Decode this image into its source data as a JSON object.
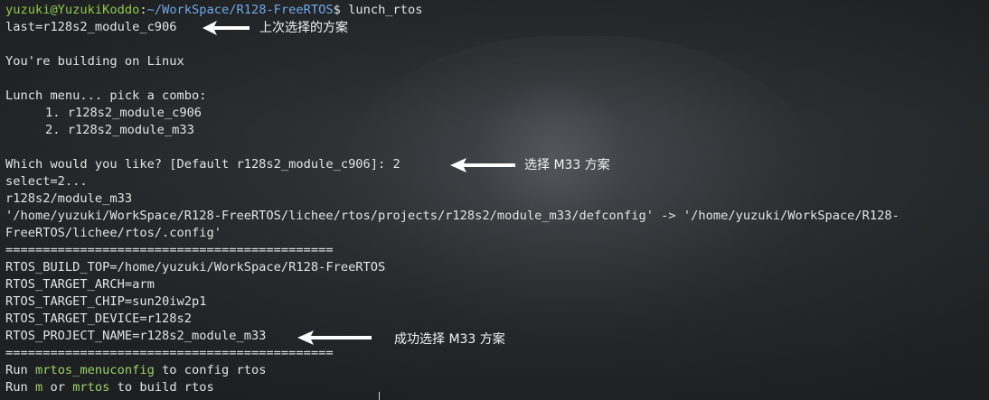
{
  "prompt": {
    "user_host": "yuzuki@YuzukiKoddo",
    "path": "~/WorkSpace/R128-FreeRTOS",
    "symbol": "$",
    "command": "lunch_rtos"
  },
  "lines": [
    "last=r128s2_module_c906",
    "",
    "You're building on Linux",
    "",
    "Lunch menu... pick a combo:",
    "1. r128s2_module_c906",
    "2. r128s2_module_m33",
    "",
    "Which would you like? [Default r128s2_module_c906]: 2",
    "select=2...",
    "r128s2/module_m33",
    "'/home/yuzuki/WorkSpace/R128-FreeRTOS/lichee/rtos/projects/r128s2/module_m33/defconfig' -> '/home/yuzuki/WorkSpace/R128-",
    "FreeRTOS/lichee/rtos/.config'",
    "============================================",
    "RTOS_BUILD_TOP=/home/yuzuki/WorkSpace/R128-FreeRTOS",
    "RTOS_TARGET_ARCH=arm",
    "RTOS_TARGET_CHIP=sun20iw2p1",
    "RTOS_TARGET_DEVICE=r128s2",
    "RTOS_PROJECT_NAME=r128s2_module_m33",
    "============================================"
  ],
  "run1": {
    "prefix": "Run ",
    "cmd": "mrtos_menuconfig",
    "suffix": " to config rtos"
  },
  "run2": {
    "prefix": "Run ",
    "cmd1": "m",
    "mid": " or ",
    "cmd2": "mrtos",
    "suffix": " to build rtos"
  },
  "annotations": {
    "last": "上次选择的方案",
    "select": "选择 M33 方案",
    "success": "成功选择 M33 方案"
  },
  "colors": {
    "user_host": "#8fc94a",
    "path": "#6ea8e8",
    "command_highlight": "#9ad267",
    "text": "#e3e3e3"
  }
}
